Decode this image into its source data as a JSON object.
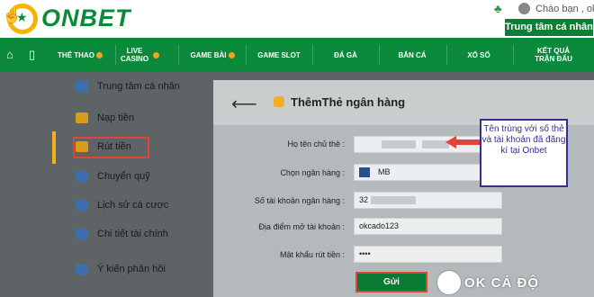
{
  "header": {
    "brand": "ONBET",
    "greeting": "Chào bạn , ok",
    "member_center_button": "Trung tâm cá nhân"
  },
  "nav": {
    "home_icon": "home-icon",
    "mobile_icon": "mobile-icon",
    "items": [
      {
        "label": "THỂ THAO",
        "hot": true
      },
      {
        "label": "LIVE CASINO",
        "hot": true
      },
      {
        "label": "GAME BÀI",
        "hot": true
      },
      {
        "label": "GAME SLOT",
        "hot": false
      },
      {
        "label": "ĐÁ GÀ",
        "hot": false
      },
      {
        "label": "BẮN CÁ",
        "hot": false
      },
      {
        "label": "XỔ SỐ",
        "hot": false
      },
      {
        "label": "KẾT QUẢ TRẬN ĐẤU",
        "hot": false
      }
    ]
  },
  "sidebar": {
    "items": [
      {
        "label": "Trung tâm cá nhân",
        "icon": "user-icon",
        "color": "#3b6fb0"
      },
      {
        "label": "Nạp tiền",
        "icon": "deposit-icon",
        "color": "#d89b1a"
      },
      {
        "label": "Rút tiền",
        "icon": "withdraw-icon",
        "color": "#d89b1a"
      },
      {
        "label": "Chuyển quỹ",
        "icon": "transfer-icon",
        "color": "#3b6fb0"
      },
      {
        "label": "Lịch sử cá cược",
        "icon": "history-icon",
        "color": "#3b6fb0"
      },
      {
        "label": "Chi tiết tài chính",
        "icon": "finance-icon",
        "color": "#3b6fb0"
      },
      {
        "label": "Ý kiến phản hồi",
        "icon": "feedback-icon",
        "color": "#3b6fb0"
      }
    ],
    "active_index": 2
  },
  "form": {
    "title": "ThêmThẻ ngân hàng",
    "fields": {
      "holder_label": "Họ tên chủ thẻ :",
      "bank_label": "Chọn ngân hàng :",
      "bank_value": "MB",
      "account_label": "Số tài khoản ngân hàng :",
      "account_value": "32",
      "branch_label": "Địa điểm mở tài khoản :",
      "branch_value": "okcado123",
      "password_label": "Mật khẩu rút tiền :",
      "password_value": "••••"
    },
    "submit_label": "Gửi"
  },
  "annotation": {
    "text": "Tên trùng với số thẻ và tài khoản đã đăng kí tại Onbet"
  },
  "watermark": "OK CÁ ĐỘ",
  "colors": {
    "brand_green": "#0c8a3c",
    "accent_gold": "#f0b020",
    "highlight_red": "#e0453a"
  }
}
